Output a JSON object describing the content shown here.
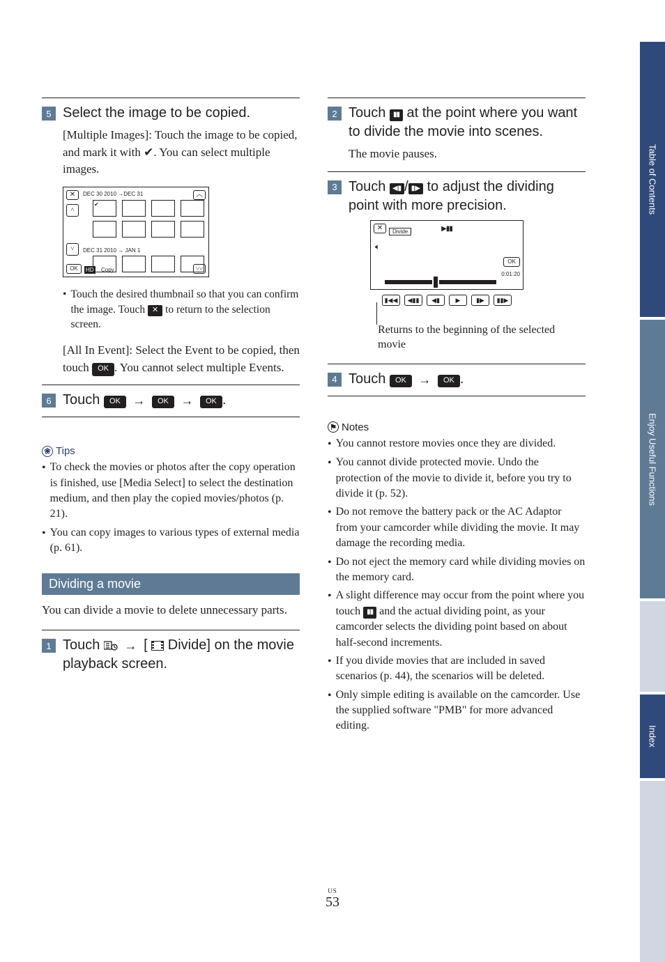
{
  "sideTabs": {
    "tab1": "Table of Contents",
    "tab2": "Enjoy Useful Functions",
    "tab3": "Index"
  },
  "pageFooter": {
    "region": "US",
    "number": "53"
  },
  "left": {
    "step5": {
      "num": "5",
      "head": "Select the image to be copied.",
      "body1_pre": "[Multiple Images]: Touch the image to be copied, and mark it with ",
      "body1_post": ". You can select multiple images.",
      "fig": {
        "date1": "DEC 30 2010 →DEC 31",
        "date2": "DEC 31 2010 → JAN 1",
        "ok": "OK",
        "hd": "HD",
        "copy": "Copy"
      },
      "subbullet_a": "Touch the desired thumbnail so that you can confirm the image. Touch ",
      "subbullet_b": " to return to the selection screen.",
      "body2_pre": "[All In Event]: Select the Event to be copied, then touch ",
      "body2_post": ". You cannot select multiple Events."
    },
    "step6": {
      "num": "6",
      "head_pre": "Touch ",
      "ok": "OK"
    },
    "tipsLabel": "Tips",
    "tips": [
      "To check the movies or photos after the copy operation is finished, use [Media Select] to select the destination medium, and then play the copied movies/photos (p. 21).",
      "You can copy images to various types of external media (p. 61)."
    ],
    "sectionTitle": "Dividing a movie",
    "sectionIntro": "You can divide a movie to delete unnecessary parts.",
    "step1": {
      "num": "1",
      "head_a": "Touch ",
      "head_b": " [",
      "head_c": " Divide] on the movie playback screen."
    }
  },
  "right": {
    "step2": {
      "num": "2",
      "head_a": "Touch ",
      "head_b": " at the point where you want to divide the movie into scenes.",
      "body": "The movie pauses."
    },
    "step3": {
      "num": "3",
      "head_a": "Touch ",
      "head_b": " to adjust the dividing point with more precision.",
      "fig": {
        "divide": "Divide",
        "ok": "OK",
        "time": "0:01:20"
      },
      "caption": "Returns to the beginning of the selected movie"
    },
    "step4": {
      "num": "4",
      "head_pre": "Touch ",
      "ok": "OK"
    },
    "notesLabel": "Notes",
    "notes": [
      "You cannot restore movies once they are divided.",
      "You cannot divide protected movie. Undo the protection of the movie to divide it, before you try to divide it (p. 52).",
      "Do not remove the battery pack or the AC Adaptor from your camcorder while dividing the movie. It may damage the recording media.",
      "Do not eject the memory card while dividing movies on the memory card.",
      "A slight difference may occur from the point where you touch __PAUSE__ and the actual dividing point, as your camcorder selects the dividing point based on about half-second increments.",
      "If you divide movies that are included in saved scenarios (p. 44), the scenarios will be deleted.",
      "Only simple editing is available on the camcorder. Use the supplied software \"PMB\" for more advanced editing."
    ]
  }
}
